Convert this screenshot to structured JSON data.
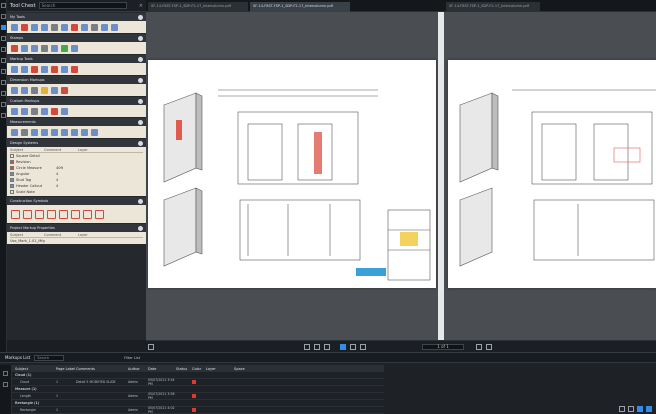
{
  "tool_chest": {
    "title": "Tool Chest",
    "search_placeholder": "Search",
    "groups": [
      {
        "title": "My Tools",
        "tools": [
          "#6c8fc7",
          "#d04a3f",
          "#6c8fc7",
          "#6c8fc7",
          "#7a7f86",
          "#6c8fc7",
          "#d04a3f",
          "#6c8fc7",
          "#7a7f86",
          "#6c8fc7",
          "#6c8fc7"
        ]
      },
      {
        "title": "Stamps",
        "tools": [
          "#d04a3f",
          "#6c8fc7",
          "#6c8fc7",
          "#7a7f86",
          "#6c8fc7",
          "#47a94e",
          "#6c8fc7"
        ]
      },
      {
        "title": "Markup Tools",
        "tools": [
          "#6c8fc7",
          "#6c8fc7",
          "#d04a3f",
          "#6c8fc7",
          "#d04a3f",
          "#6c8fc7",
          "#d04a3f"
        ]
      },
      {
        "title": "Dimension Markups",
        "tools": [
          "#6c8fc7",
          "#6c8fc7",
          "#7a7f86",
          "#e0b23a",
          "#6c8fc7",
          "#d04a3f"
        ]
      },
      {
        "title": "Custom Markups",
        "tools": [
          "#6c8fc7",
          "#6c8fc7",
          "#7a7f86",
          "#6c8fc7",
          "#d04a3f",
          "#6c8fc7"
        ]
      },
      {
        "title": "Measurements",
        "tools": [
          "#6c8fc7",
          "#7a7f86",
          "#6c8fc7",
          "#6c8fc7",
          "#6c8fc7",
          "#6c8fc7",
          "#6c8fc7",
          "#6c8fc7",
          "#6c8fc7"
        ]
      }
    ],
    "design_group": {
      "title": "Design Systems",
      "columns": [
        "Subject",
        "Comment",
        "Layer"
      ],
      "rows": [
        {
          "k": "Square Detail",
          "v": "",
          "swatch": "#ebe6d8"
        },
        {
          "k": "Revision",
          "v": "",
          "swatch": "#d04a3f"
        },
        {
          "k": "Circle Measure",
          "v": "40ft",
          "swatch": "#d04a3f"
        },
        {
          "k": "Angular",
          "v": "4",
          "swatch": "#6c8fc7"
        },
        {
          "k": "Stud Tag",
          "v": "4",
          "swatch": "#6c8fc7"
        },
        {
          "k": "Header Callout",
          "v": "4",
          "swatch": "#6c8fc7"
        },
        {
          "k": "Scale Note",
          "v": "",
          "swatch": "#ebe6d8"
        }
      ]
    },
    "measure_group": {
      "title": "Construction Symbols",
      "tools": [
        "#d04a3f",
        "#d04a3f",
        "#d04a3f",
        "#d04a3f",
        "#d04a3f",
        "#d04a3f",
        "#d04a3f",
        "#d04a3f"
      ]
    },
    "props_group": {
      "title": "Project Markup Properties",
      "columns": [
        "Subject",
        "Comment",
        "Layer"
      ],
      "rows": [
        {
          "k": "Use_Mark_1.01_Mfg",
          "v": ""
        }
      ]
    }
  },
  "tabs": [
    {
      "label": "SF-14-F8ST-FSP-1_SDP-F2-17_Intercolumn.pdf"
    },
    {
      "label": "SF-14-F8ST-FSP-1_SDP-F2-17_Intercolumn.pdf"
    },
    {
      "label": "SF-14-F8ST-FSP-1_SDP-F2-17_Intercolumn.pdf"
    }
  ],
  "navigation": {
    "page_field": "1 of 1"
  },
  "markups_list": {
    "title": "Markups List",
    "search_placeholder": "Search",
    "filter_label": "Filter List",
    "columns": [
      "Subject",
      "Page Label",
      "Comments",
      "Author",
      "Date",
      "Status",
      "Color",
      "Layer",
      "Space"
    ],
    "rows": [
      {
        "subject": "Cloud (1)",
        "page": "",
        "comment": "",
        "author": "",
        "date": "",
        "status": "",
        "color": "",
        "layer": "",
        "space": ""
      },
      {
        "subject": "Cloud",
        "page": "1",
        "comment": "Detail 5 MODIFIED SLIDE",
        "author": "Admin",
        "date": "05/07/2021 3:54 PM",
        "status": "",
        "color": "#e03a2f",
        "layer": "",
        "space": ""
      },
      {
        "subject": "Measure (1)",
        "page": "",
        "comment": "",
        "author": "",
        "date": "",
        "status": "",
        "color": "",
        "layer": "",
        "space": ""
      },
      {
        "subject": "Length",
        "page": "1",
        "comment": "",
        "author": "Admin",
        "date": "05/07/2021 3:56 PM",
        "status": "",
        "color": "#e03a2f",
        "layer": "",
        "space": ""
      },
      {
        "subject": "Rectangle (1)",
        "page": "",
        "comment": "",
        "author": "",
        "date": "",
        "status": "",
        "color": "",
        "layer": "",
        "space": ""
      },
      {
        "subject": "Rectangle",
        "page": "1",
        "comment": "",
        "author": "Admin",
        "date": "05/07/2021 4:02 PM",
        "status": "",
        "color": "#e03a2f",
        "layer": "",
        "space": ""
      }
    ]
  },
  "colors": {
    "accent": "#2f8ee8",
    "markup_red": "#e03a2f",
    "tray": "#ebe6d8"
  }
}
